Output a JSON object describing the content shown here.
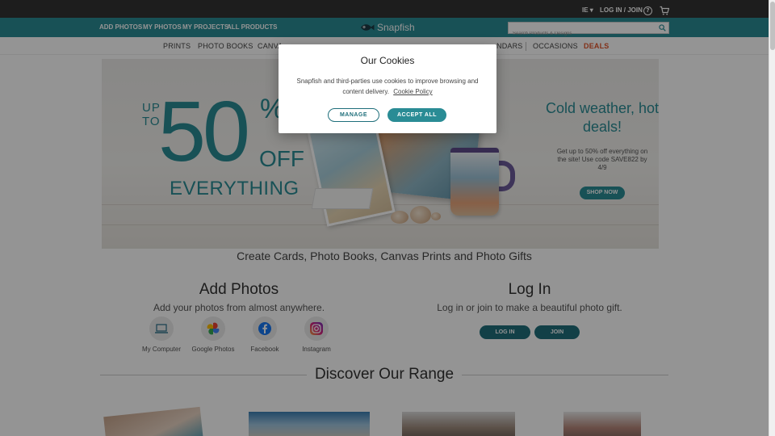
{
  "utility_bar": {
    "country": "IE",
    "login_join": "LOG IN / JOIN"
  },
  "top_nav": {
    "links": [
      "ADD PHOTOS",
      "MY PHOTOS",
      "MY PROJECTS",
      "ALL PRODUCTS"
    ],
    "logo": "Snapfish",
    "search_placeholder": "Search Products & Designs"
  },
  "categories": {
    "items": [
      "PRINTS",
      "PHOTO BOOKS",
      "CANVAS",
      "",
      "",
      "",
      "CALENDARS",
      "OCCASIONS",
      "DEALS"
    ],
    "visible": [
      "PRINTS",
      "PHOTO BOOKS",
      "CANVA",
      "NDARS",
      "OCCASIONS",
      "DEALS"
    ]
  },
  "hero": {
    "up_to": "UP TO",
    "percent": "50",
    "percent_sign": "%",
    "off": "OFF",
    "everything": "EVERYTHING",
    "headline": "Cold weather, hot deals!",
    "subtext": "Get up to 50% off everything on the site! Use code SAVE822 by 4/9",
    "cta": "SHOP NOW"
  },
  "tagline": "Create Cards, Photo Books, Canvas Prints and Photo Gifts",
  "add_photos": {
    "title": "Add Photos",
    "subtitle": "Add your photos from almost anywhere.",
    "sources": [
      "My Computer",
      "Google Photos",
      "Facebook",
      "Instagram"
    ]
  },
  "login": {
    "title": "Log In",
    "subtitle": "Log in or join to make a beautiful photo gift.",
    "login_button": "LOG IN",
    "join_button": "JOIN"
  },
  "discover": {
    "title": "Discover Our Range"
  },
  "cookie_modal": {
    "title": "Our Cookies",
    "text": "Snapfish and third-parties use cookies to improve browsing and content delivery.",
    "link": "Cookie Policy",
    "manage": "MANAGE",
    "accept_all": "ACCEPT ALL"
  },
  "colors": {
    "teal": "#2a8c95",
    "dark_teal": "#1f6f7b",
    "topbar": "#333333",
    "deals": "#e0552b"
  }
}
